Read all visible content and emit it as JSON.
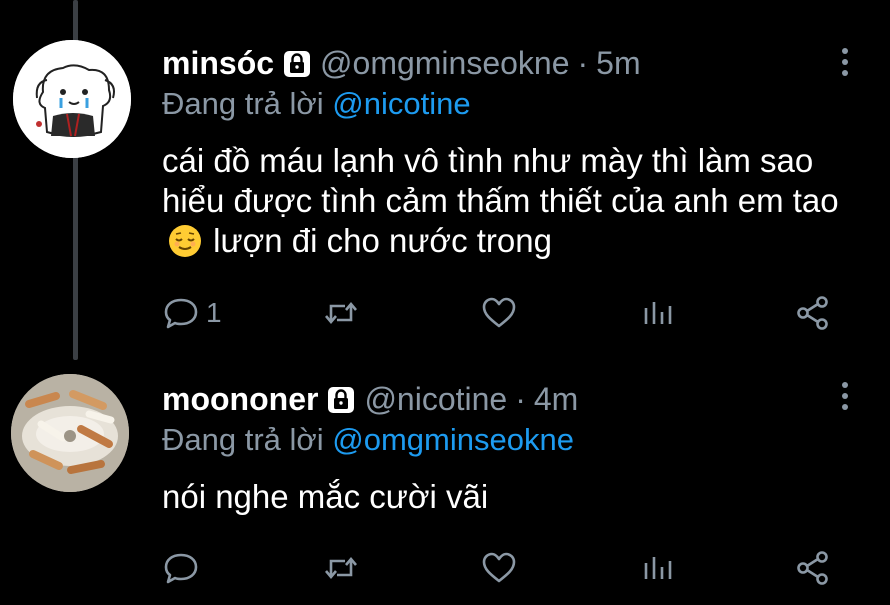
{
  "tweets": [
    {
      "name": "minsóc",
      "handle": "@omgminseokne",
      "separator": "·",
      "time": "5m",
      "reply_prefix": "Đang trả lời",
      "reply_to": "@nicotine",
      "text_before_emoji": "cái đồ máu lạnh vô tình như mày thì làm sao hiểu được tình cảm thấm thiết của anh em tao",
      "text_after_emoji": "lượn đi cho nước trong",
      "emoji": "relieved-face",
      "reply_count": "1"
    },
    {
      "name": "moononer",
      "handle": "@nicotine",
      "separator": "·",
      "time": "4m",
      "reply_prefix": "Đang trả lời",
      "reply_to": "@omgminseokne",
      "text": "nói nghe mắc cười vãi",
      "reply_count": ""
    }
  ],
  "colors": {
    "background": "#000000",
    "secondary_text": "#8b98a5",
    "mention": "#1d9bf0",
    "thread_line": "#3b3f44"
  },
  "icons": {
    "lock": "lock-icon",
    "more": "more-vertical-icon",
    "reply": "reply-icon",
    "retweet": "retweet-icon",
    "like": "heart-icon",
    "stats": "stats-icon",
    "share": "share-icon"
  }
}
